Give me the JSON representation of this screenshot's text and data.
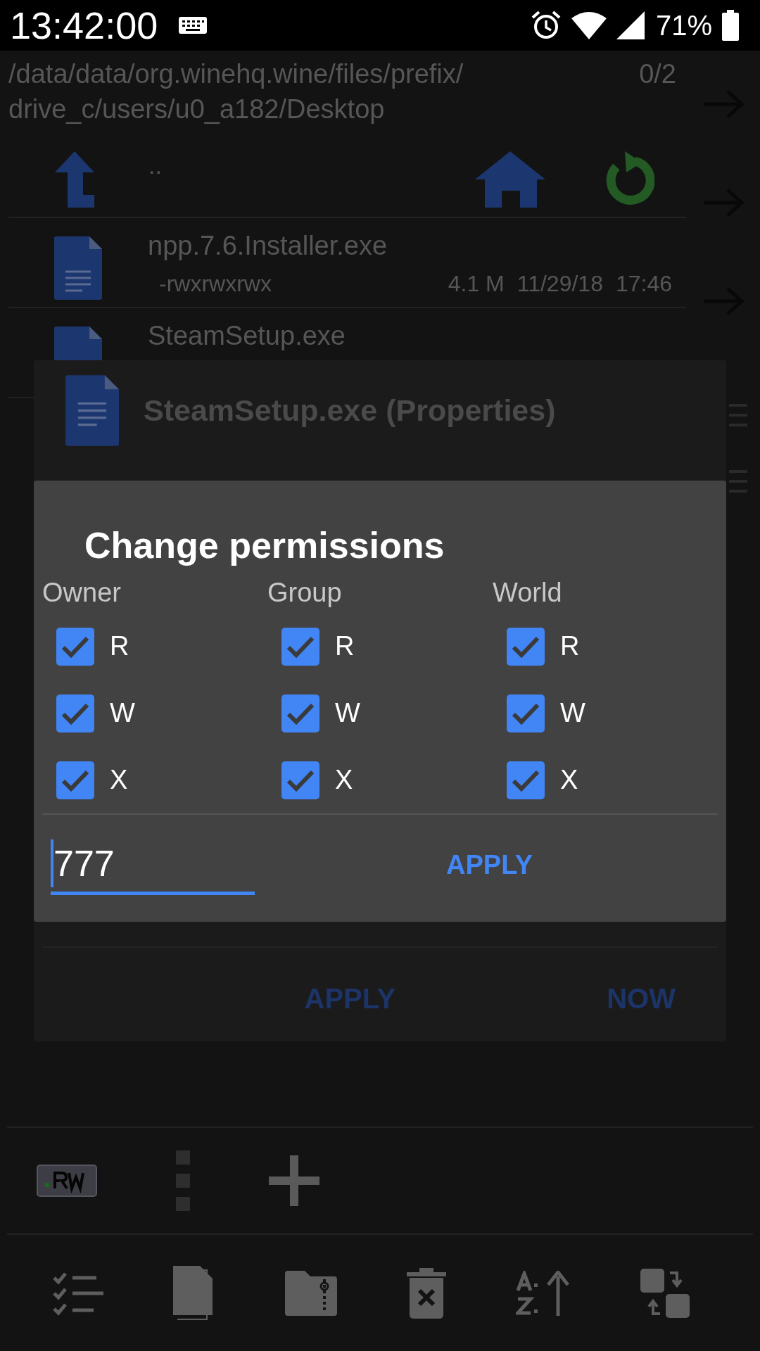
{
  "status_bar": {
    "time": "13:42:00",
    "battery": "71%"
  },
  "path": {
    "lines": [
      "/data/data/org.winehq.wine/files/prefix/",
      "drive_c/users/u0_a182/Desktop"
    ],
    "count": "0/2"
  },
  "nav": {
    "parent": ".."
  },
  "files": [
    {
      "name": "npp.7.6.Installer.exe",
      "permissions": "-rwxrwxrwx",
      "size": "4.1 M",
      "date": "11/29/18",
      "time": "17:46"
    },
    {
      "name": "SteamSetup.exe"
    }
  ],
  "properties_dialog": {
    "title": "SteamSetup.exe (Properties)",
    "buttons": [
      "APPLY",
      "NOW"
    ]
  },
  "permissions_dialog": {
    "title": "Change permissions",
    "columns": [
      {
        "label": "Owner",
        "perms": [
          {
            "label": "R",
            "checked": true
          },
          {
            "label": "W",
            "checked": true
          },
          {
            "label": "X",
            "checked": true
          }
        ]
      },
      {
        "label": "Group",
        "perms": [
          {
            "label": "R",
            "checked": true
          },
          {
            "label": "W",
            "checked": true
          },
          {
            "label": "X",
            "checked": true
          }
        ]
      },
      {
        "label": "World",
        "perms": [
          {
            "label": "R",
            "checked": true
          },
          {
            "label": "W",
            "checked": true
          },
          {
            "label": "X",
            "checked": true
          }
        ]
      }
    ],
    "mode": "777",
    "apply": "APPLY"
  }
}
